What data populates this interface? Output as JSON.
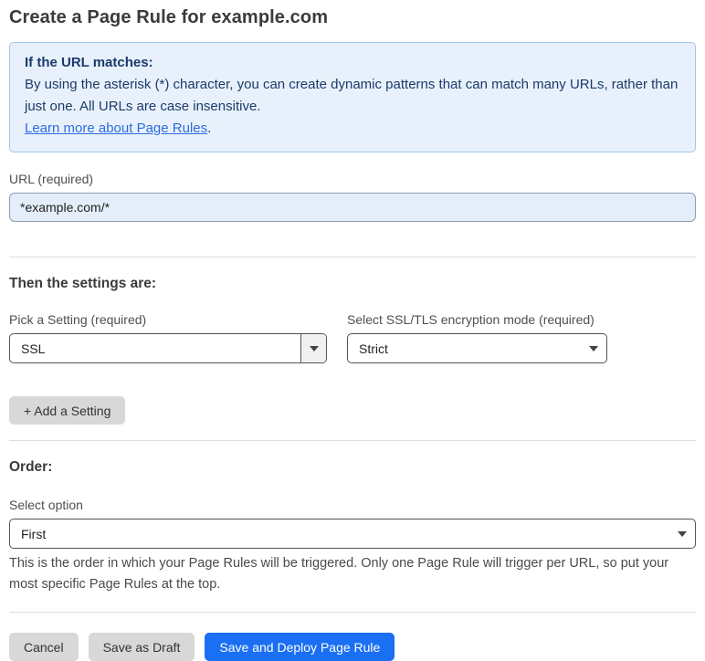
{
  "colors": {
    "accent_blue": "#1a6ff2",
    "info_background": "#e8f1fb",
    "info_border": "#a3c6e8",
    "info_text": "#1b3a6b",
    "link_blue": "#2c6cdf",
    "input_background": "#e4eefb",
    "gray_button": "#d8d8d8"
  },
  "header": {
    "title": "Create a Page Rule for example.com"
  },
  "info_box": {
    "heading": "If the URL matches:",
    "body": "By using the asterisk (*) character, you can create dynamic patterns that can match many URLs, rather than just one. All URLs are case insensitive.",
    "link_label": "Learn more about Page Rules",
    "link_suffix": "."
  },
  "url_field": {
    "label": "URL (required)",
    "value": "*example.com/*"
  },
  "settings_section": {
    "heading": "Then the settings are:",
    "setting_picker": {
      "label": "Pick a Setting (required)",
      "value": "SSL"
    },
    "ssl_mode_picker": {
      "label": "Select SSL/TLS encryption mode (required)",
      "value": "Strict"
    },
    "add_setting_label": "+ Add a Setting"
  },
  "order_section": {
    "heading": "Order:",
    "select_label": "Select option",
    "value": "First",
    "help_text": "This is the order in which your Page Rules will be triggered. Only one Page Rule will trigger per URL, so put your most specific Page Rules at the top."
  },
  "footer": {
    "cancel_label": "Cancel",
    "save_draft_label": "Save as Draft",
    "save_deploy_label": "Save and Deploy Page Rule"
  }
}
